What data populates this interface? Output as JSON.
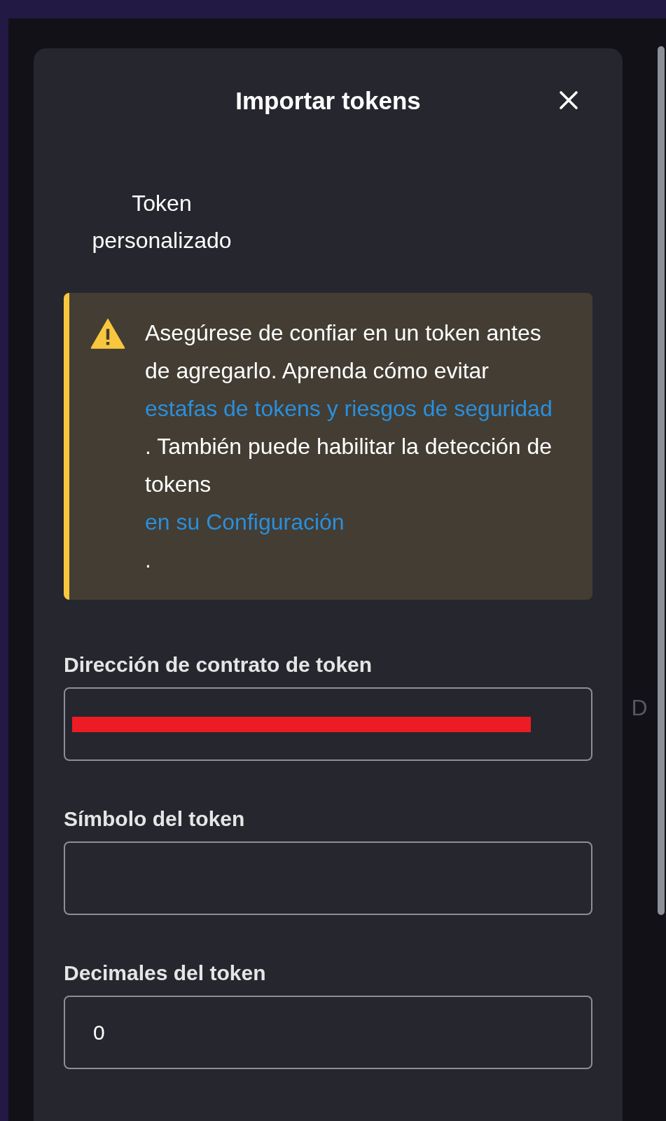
{
  "dialog": {
    "title": "Importar tokens"
  },
  "tabs": [
    {
      "label": "Token personalizado",
      "selected": true
    }
  ],
  "warning": {
    "parts": [
      {
        "kind": "text",
        "text": "Asegúrese de confiar en un token antes de agregarlo. Aprenda cómo evitar"
      },
      {
        "kind": "link",
        "text": "estafas de tokens y riesgos de seguridad"
      },
      {
        "kind": "text",
        "text": ". También puede habilitar la detección de tokens"
      },
      {
        "kind": "link",
        "text": "en su Configuración"
      },
      {
        "kind": "text",
        "text": "."
      }
    ]
  },
  "fields": [
    {
      "label": "Dirección de contrato de token",
      "redacted": true
    },
    {
      "label": "Símbolo del token",
      "redacted": false
    },
    {
      "label": "Decimales del token",
      "value": "0",
      "redacted": false
    }
  ],
  "background_text": "D"
}
